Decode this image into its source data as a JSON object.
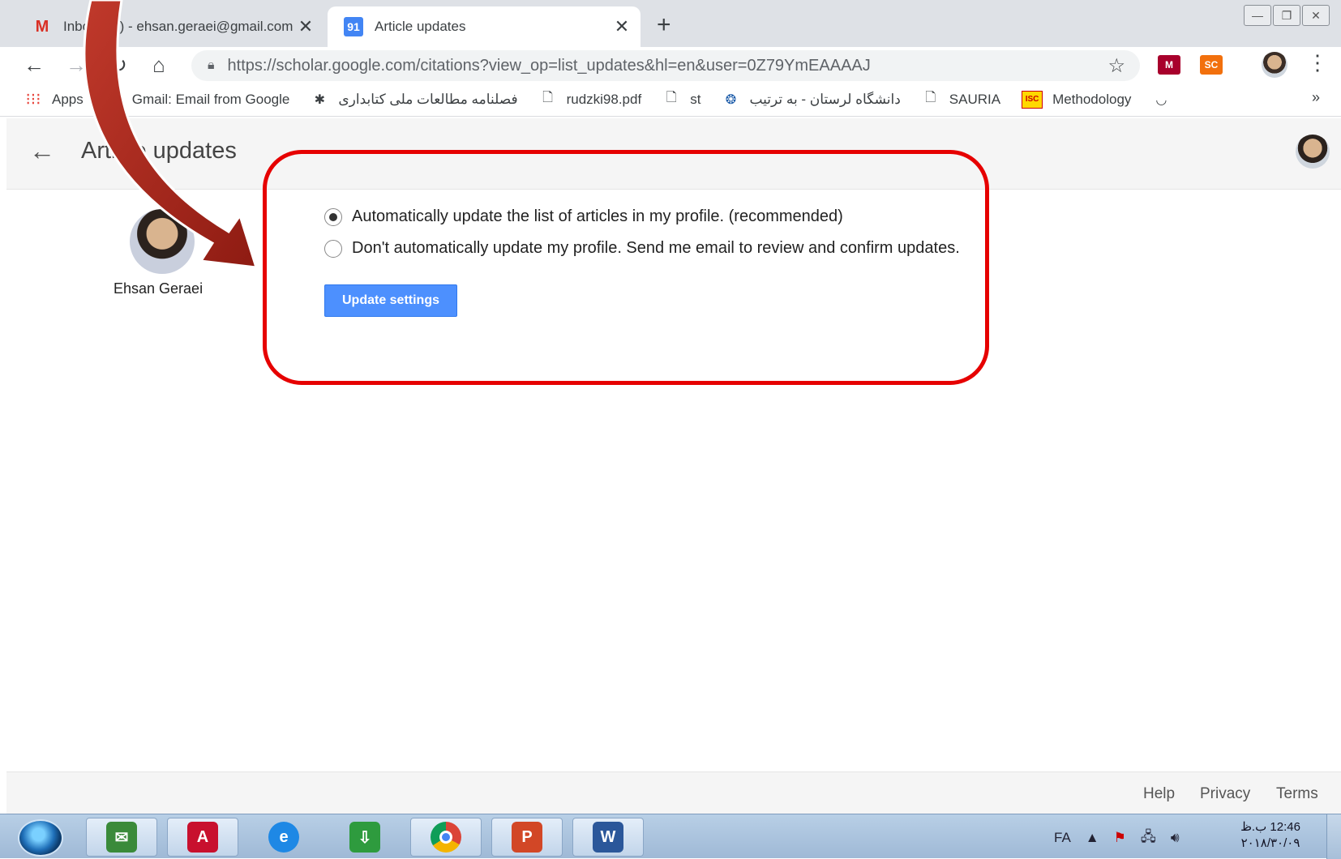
{
  "browser": {
    "tabs": [
      {
        "title": "Inbox (11) - ehsan.geraei@gmail.com",
        "icon": "gmail-icon",
        "active": false
      },
      {
        "title": "Article updates",
        "icon": "scholar-icon",
        "active": true
      }
    ],
    "close_glyph": "✕",
    "new_tab_glyph": "+",
    "window_controls": [
      "—",
      "❐",
      "✕"
    ],
    "url": "https://scholar.google.com/citations?view_op=list_updates&hl=en&user=0Z79YmEAAAAJ",
    "extensions": [
      {
        "name": "mendeley-icon",
        "label": "M",
        "color": "#a8002c"
      },
      {
        "name": "sc-extension-icon",
        "label": "SC",
        "color": "#f2700d"
      }
    ]
  },
  "bookmarks": [
    {
      "label": "Apps",
      "icon": "apps-grid-icon"
    },
    {
      "label": "Gmail: Email from Google",
      "icon": "google-icon"
    },
    {
      "label": "فصلنامه مطالعات ملی کتابداری",
      "icon": "journal-logo-icon"
    },
    {
      "label": "rudzki98.pdf",
      "icon": "page-icon"
    },
    {
      "label": "st",
      "icon": "page-icon"
    },
    {
      "label": "دانشگاه لرستان - به ترتیب",
      "icon": "university-logo-icon"
    },
    {
      "label": "SAURIA",
      "icon": "page-icon"
    },
    {
      "label": "Methodology",
      "icon": "isc-icon"
    }
  ],
  "bookmarks_more": "»",
  "page": {
    "title": "Article updates",
    "profile_name": "Ehsan Geraei",
    "options": [
      {
        "label": "Automatically update the list of articles in my profile. (recommended)",
        "checked": true
      },
      {
        "label": "Don't automatically update my profile. Send me email to review and confirm updates.",
        "checked": false
      }
    ],
    "update_button": "Update settings"
  },
  "footer": {
    "links": [
      "Help",
      "Privacy",
      "Terms"
    ]
  },
  "taskbar": {
    "apps": [
      {
        "name": "mail-app-icon",
        "label": "",
        "color": "#3a8a3a"
      },
      {
        "name": "acrobat-app-icon",
        "label": "A",
        "color": "#c8102e"
      },
      {
        "name": "ie-app-icon",
        "label": "e",
        "color": "#1e88e5"
      },
      {
        "name": "download-manager-icon",
        "label": "⇩",
        "color": "#2e9b3e"
      },
      {
        "name": "chrome-app-icon",
        "label": "",
        "color": "#db4437"
      },
      {
        "name": "powerpoint-app-icon",
        "label": "P",
        "color": "#d24726"
      },
      {
        "name": "word-app-icon",
        "label": "W",
        "color": "#2b579a"
      }
    ],
    "language": "FA",
    "time": "12:46 ب.ظ",
    "date": "۲۰۱۸/۳۰/۰۹"
  }
}
